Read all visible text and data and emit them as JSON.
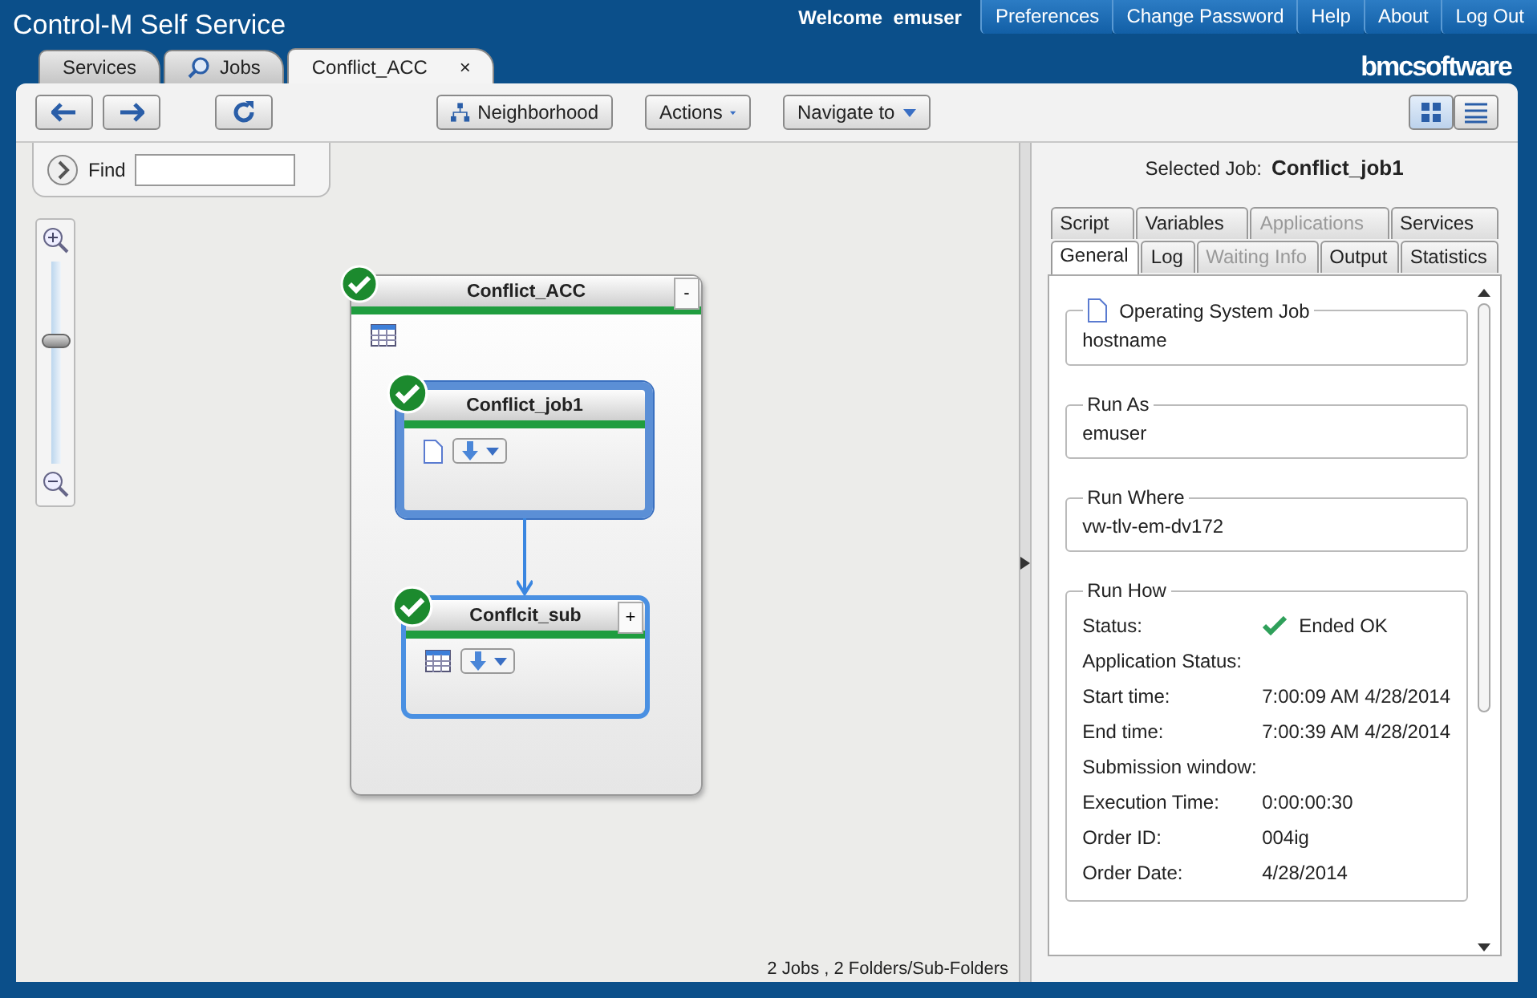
{
  "app_title": "Control-M Self Service",
  "greeting": {
    "label": "Welcome",
    "user": "emuser"
  },
  "top_links": [
    "Preferences",
    "Change Password",
    "Help",
    "About",
    "Log Out"
  ],
  "logo": "bmcsoftware",
  "tabs": [
    {
      "label": "Services",
      "selected": false,
      "icon": false
    },
    {
      "label": "Jobs",
      "selected": false,
      "icon": true
    },
    {
      "label": "Conflict_ACC",
      "selected": true,
      "icon": false,
      "close": "×"
    }
  ],
  "toolbar": {
    "neighborhood": "Neighborhood",
    "actions": "Actions",
    "navigate": "Navigate to",
    "view_buttons": [
      {
        "selected": true
      },
      {
        "selected": false
      }
    ]
  },
  "find": {
    "label": "Find"
  },
  "zoom": {
    "level": 0.6
  },
  "nodes": [
    {
      "kind": "folder",
      "name": "Conflict_ACC",
      "selected": false,
      "toggle": "-"
    },
    {
      "kind": "job",
      "name": "Conflict_job1",
      "selected": true
    },
    {
      "kind": "subfolder",
      "name": "Conflcit_sub",
      "selected": false,
      "toggle": "+"
    }
  ],
  "status_bar": "2 Jobs , 2 Folders/Sub-Folders",
  "selected_job": {
    "label": "Selected Job:",
    "name": "Conflict_job1"
  },
  "detail_tabs": [
    [
      {
        "label": "Script",
        "selected": false,
        "disabled": false
      },
      {
        "label": "Variables",
        "selected": false,
        "disabled": false
      },
      {
        "label": "Applications",
        "selected": false,
        "disabled": true
      },
      {
        "label": "Services",
        "selected": false,
        "disabled": false
      }
    ],
    [
      {
        "label": "General",
        "selected": true,
        "disabled": false
      },
      {
        "label": "Log",
        "selected": false,
        "disabled": false
      },
      {
        "label": "Waiting Info",
        "selected": false,
        "disabled": true
      },
      {
        "label": "Output",
        "selected": false,
        "disabled": false
      },
      {
        "label": "Statistics",
        "selected": false,
        "disabled": false
      }
    ]
  ],
  "sections": [
    {
      "kind": "field",
      "legend": "Operating System Job",
      "icon": true,
      "value": "hostname"
    },
    {
      "kind": "field",
      "legend": "Run As",
      "icon": false,
      "value": "emuser"
    },
    {
      "kind": "field",
      "legend": "Run Where",
      "icon": false,
      "value": "vw-tlv-em-dv172"
    },
    {
      "kind": "details",
      "legend": "Run How",
      "rows": [
        {
          "label": "Status:",
          "value": "Ended OK",
          "ok": true
        },
        {
          "label": "Application Status:"
        },
        {
          "label": "Start time:",
          "value": "7:00:09 AM 4/28/2014"
        },
        {
          "label": "End time:",
          "value": "7:00:39 AM 4/28/2014"
        },
        {
          "label": "Submission window:"
        },
        {
          "label": "Execution Time:",
          "value": "0:00:00:30"
        },
        {
          "label": "Order ID:",
          "value": "004ig"
        },
        {
          "label": "Order Date:",
          "value": "4/28/2014"
        }
      ]
    }
  ]
}
